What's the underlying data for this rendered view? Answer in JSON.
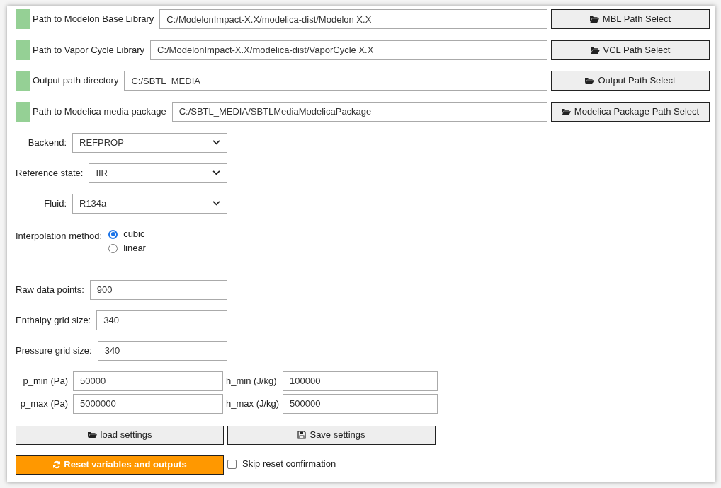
{
  "path_rows": [
    {
      "label": "Path to Modelon Base Library",
      "value": "C:/ModelonImpact-X.X/modelica-dist/Modelon X.X",
      "button": "MBL Path Select"
    },
    {
      "label": "Path to Vapor Cycle Library",
      "value": "C:/ModelonImpact-X.X/modelica-dist/VaporCycle X.X",
      "button": "VCL Path Select"
    },
    {
      "label": "Output path directory",
      "value": "C:/SBTL_MEDIA",
      "button": "Output Path Select"
    },
    {
      "label": "Path to Modelica media package",
      "value": "C:/SBTL_MEDIA/SBTLMediaModelicaPackage",
      "button": "Modelica Package Path Select"
    }
  ],
  "dropdowns": [
    {
      "label": "Backend:",
      "value": "REFPROP"
    },
    {
      "label": "Reference state:",
      "value": "IIR"
    },
    {
      "label": "Fluid:",
      "value": "R134a"
    }
  ],
  "interpolation": {
    "label": "Interpolation method:",
    "options": [
      {
        "label": "cubic",
        "selected": true
      },
      {
        "label": "linear",
        "selected": false
      }
    ]
  },
  "number_fields": [
    {
      "label": "Raw data points:",
      "value": "900"
    },
    {
      "label": "Enthalpy grid size:",
      "value": "340"
    },
    {
      "label": "Pressure grid size:",
      "value": "340"
    }
  ],
  "bounds": [
    [
      {
        "label": "p_min (Pa)",
        "value": "50000"
      },
      {
        "label": "h_min (J/kg)",
        "value": "100000"
      }
    ],
    [
      {
        "label": "p_max (Pa)",
        "value": "5000000"
      },
      {
        "label": "h_max (J/kg)",
        "value": "500000"
      }
    ]
  ],
  "settings_buttons": [
    {
      "kind": "load",
      "label": "load settings"
    },
    {
      "kind": "save",
      "label": "Save settings"
    }
  ],
  "reset_button": "Reset variables and outputs",
  "skip_confirmation": {
    "label": "Skip reset confirmation",
    "checked": false
  }
}
